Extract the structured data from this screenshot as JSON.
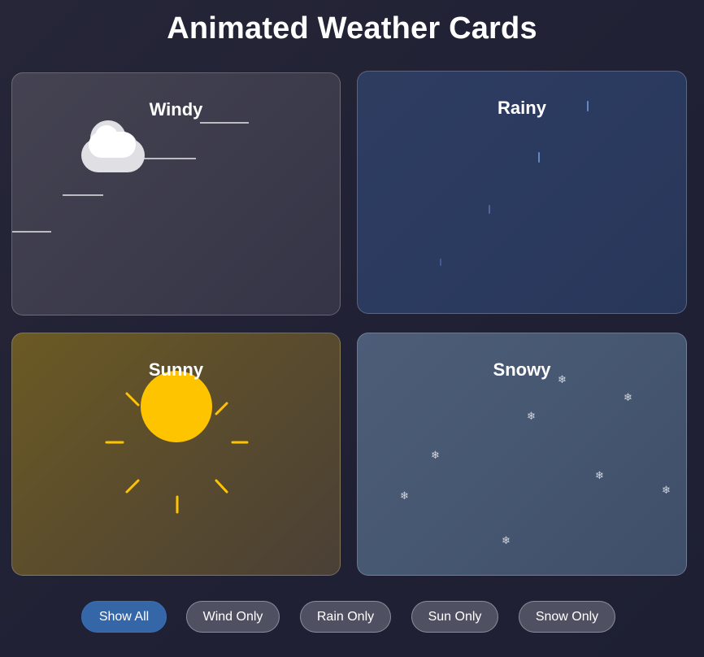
{
  "page": {
    "title": "Animated Weather Cards"
  },
  "cards": [
    {
      "id": "windy",
      "title": "Windy",
      "icon": "cloud-icon"
    },
    {
      "id": "rainy",
      "title": "Rainy",
      "icon": "raindrop-icon"
    },
    {
      "id": "sunny",
      "title": "Sunny",
      "icon": "sun-icon"
    },
    {
      "id": "snowy",
      "title": "Snowy",
      "icon": "snowflake-icon"
    }
  ],
  "snowflake_glyph": "❄",
  "filters": [
    {
      "label": "Show All",
      "active": true
    },
    {
      "label": "Wind Only",
      "active": false
    },
    {
      "label": "Rain Only",
      "active": false
    },
    {
      "label": "Sun Only",
      "active": false
    },
    {
      "label": "Snow Only",
      "active": false
    }
  ],
  "colors": {
    "sun": "#ffc400",
    "active_button": "#3466a8",
    "button": "#505063",
    "rain": "#78a0e6"
  }
}
